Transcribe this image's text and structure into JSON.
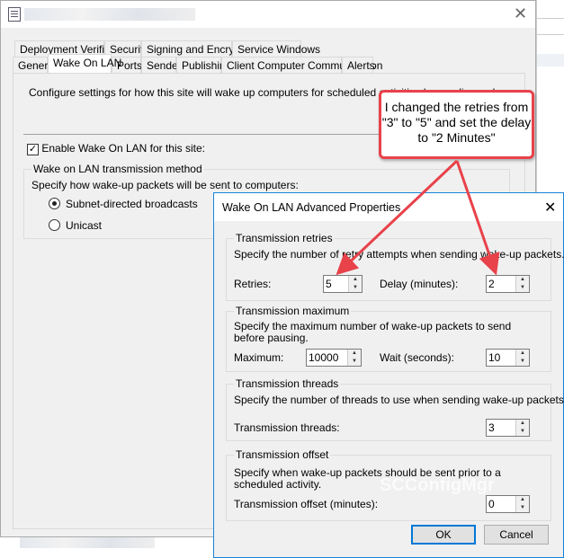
{
  "main_dialog": {
    "tabs_row1": [
      "Deployment Verification",
      "Security",
      "Signing and Encryption",
      "Service Windows"
    ],
    "tabs_row2": [
      "General",
      "Wake On LAN",
      "Ports",
      "Sender",
      "Publishing",
      "Client Computer Communication",
      "Alerts"
    ],
    "selected_tab": "Wake On LAN",
    "description": "Configure settings for how this site will wake up computers for scheduled activities by sending wake-up packets.",
    "enable_label": "Enable Wake On LAN for this site:",
    "enable_checked": true,
    "method_group": "Wake on LAN transmission method",
    "method_desc": "Specify how wake-up packets will be sent to computers:",
    "options": [
      "Subnet-directed broadcasts",
      "Unicast"
    ],
    "selected_option": "Subnet-directed broadcasts"
  },
  "advanced": {
    "title": "Wake On LAN Advanced Properties",
    "retries_group": "Transmission retries",
    "retries_desc": "Specify the number of retry attempts when sending wake-up packets.",
    "retries_label": "Retries:",
    "retries_value": "5",
    "delay_label": "Delay (minutes):",
    "delay_value": "2",
    "max_group": "Transmission maximum",
    "max_desc": "Specify the maximum number of wake-up packets to send before pausing.",
    "max_label": "Maximum:",
    "max_value": "10000",
    "wait_label": "Wait (seconds):",
    "wait_value": "10",
    "threads_group": "Transmission threads",
    "threads_desc": "Specify the number of threads to use when sending wake-up packets.",
    "threads_label": "Transmission threads:",
    "threads_value": "3",
    "offset_group": "Transmission offset",
    "offset_desc": "Specify when wake-up packets should be sent prior to a scheduled activity.",
    "offset_label": "Transmission offset (minutes):",
    "offset_value": "0",
    "ok": "OK",
    "cancel": "Cancel"
  },
  "callout": {
    "text": "I changed the retries from \"3\" to \"5\" and set the delay to \"2 Minutes\"",
    "color": "#e8424a"
  },
  "watermark": "SCConfigMgr"
}
